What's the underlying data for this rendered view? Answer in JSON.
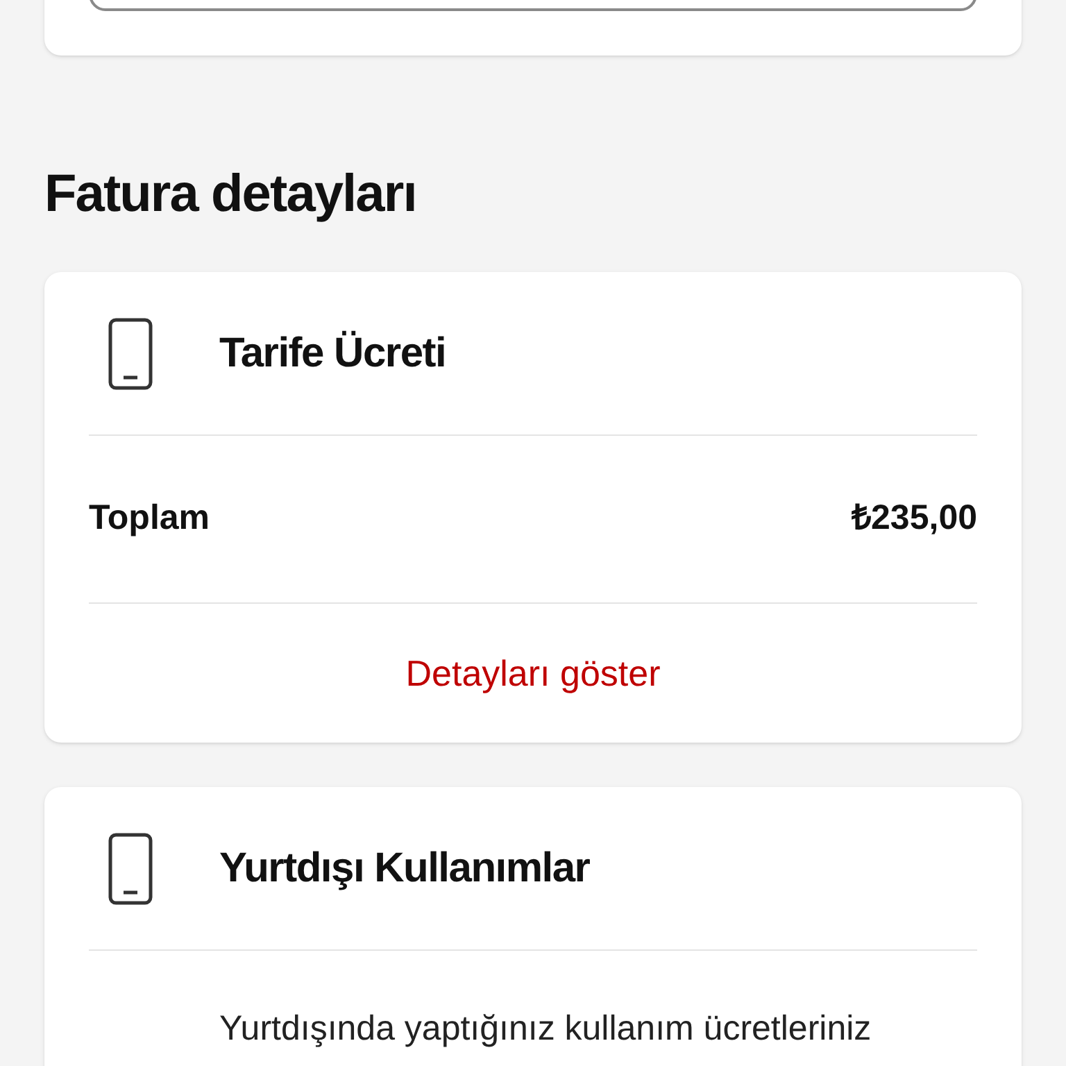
{
  "section_title": "Fatura detayları",
  "cards": [
    {
      "kind": "summary",
      "title": "Tarife Ücreti",
      "total_label": "Toplam",
      "total_value": "₺235,00",
      "link": "Detayları göster"
    },
    {
      "kind": "info",
      "title": "Yurtdışı Kullanımlar",
      "text": "Yurtdışında yaptığınız kullanım ücretleriniz"
    }
  ]
}
